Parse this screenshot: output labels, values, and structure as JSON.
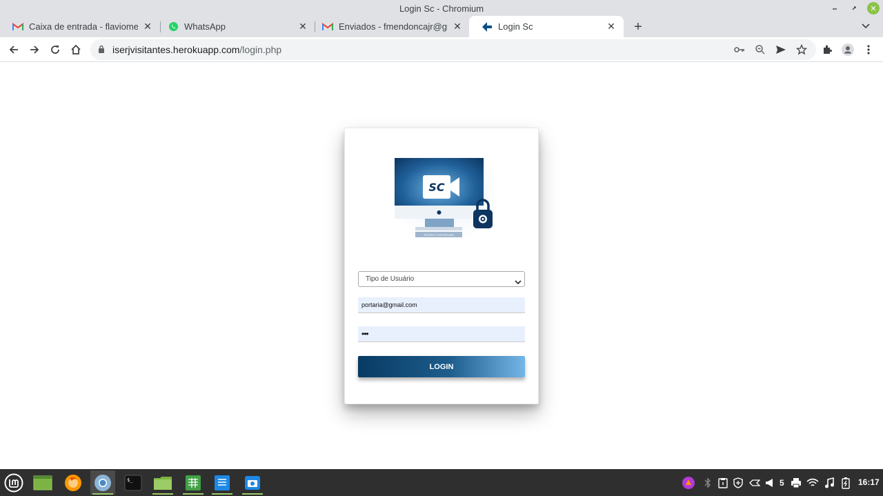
{
  "window": {
    "title": "Login Sc - Chromium"
  },
  "tabs": [
    {
      "label": "Caixa de entrada - flaviomendonca",
      "icon": "gmail-icon"
    },
    {
      "label": "WhatsApp",
      "icon": "whatsapp-icon"
    },
    {
      "label": "Enviados - fmendoncajr@gmail.com",
      "icon": "gmail-icon"
    },
    {
      "label": "Login Sc",
      "icon": "app-icon",
      "active": true
    }
  ],
  "address": {
    "domain": "iserjvisitantes.herokuapp.com",
    "path": "/login.php"
  },
  "form": {
    "user_type_selected": "Tipo de Usuário",
    "email_value": "portaria@gmail.com",
    "password_value": "•••",
    "login_label": "LOGIN"
  },
  "logo": {
    "text": "SC",
    "caption": "SECURITY CONTROLLER"
  },
  "taskbar": {
    "battery_count": "5",
    "clock": "16:17"
  },
  "colors": {
    "button_start": "#073b63",
    "button_end": "#74b6e8",
    "autofill_bg": "#e8f0fe",
    "mint_green": "#8bc34a"
  }
}
